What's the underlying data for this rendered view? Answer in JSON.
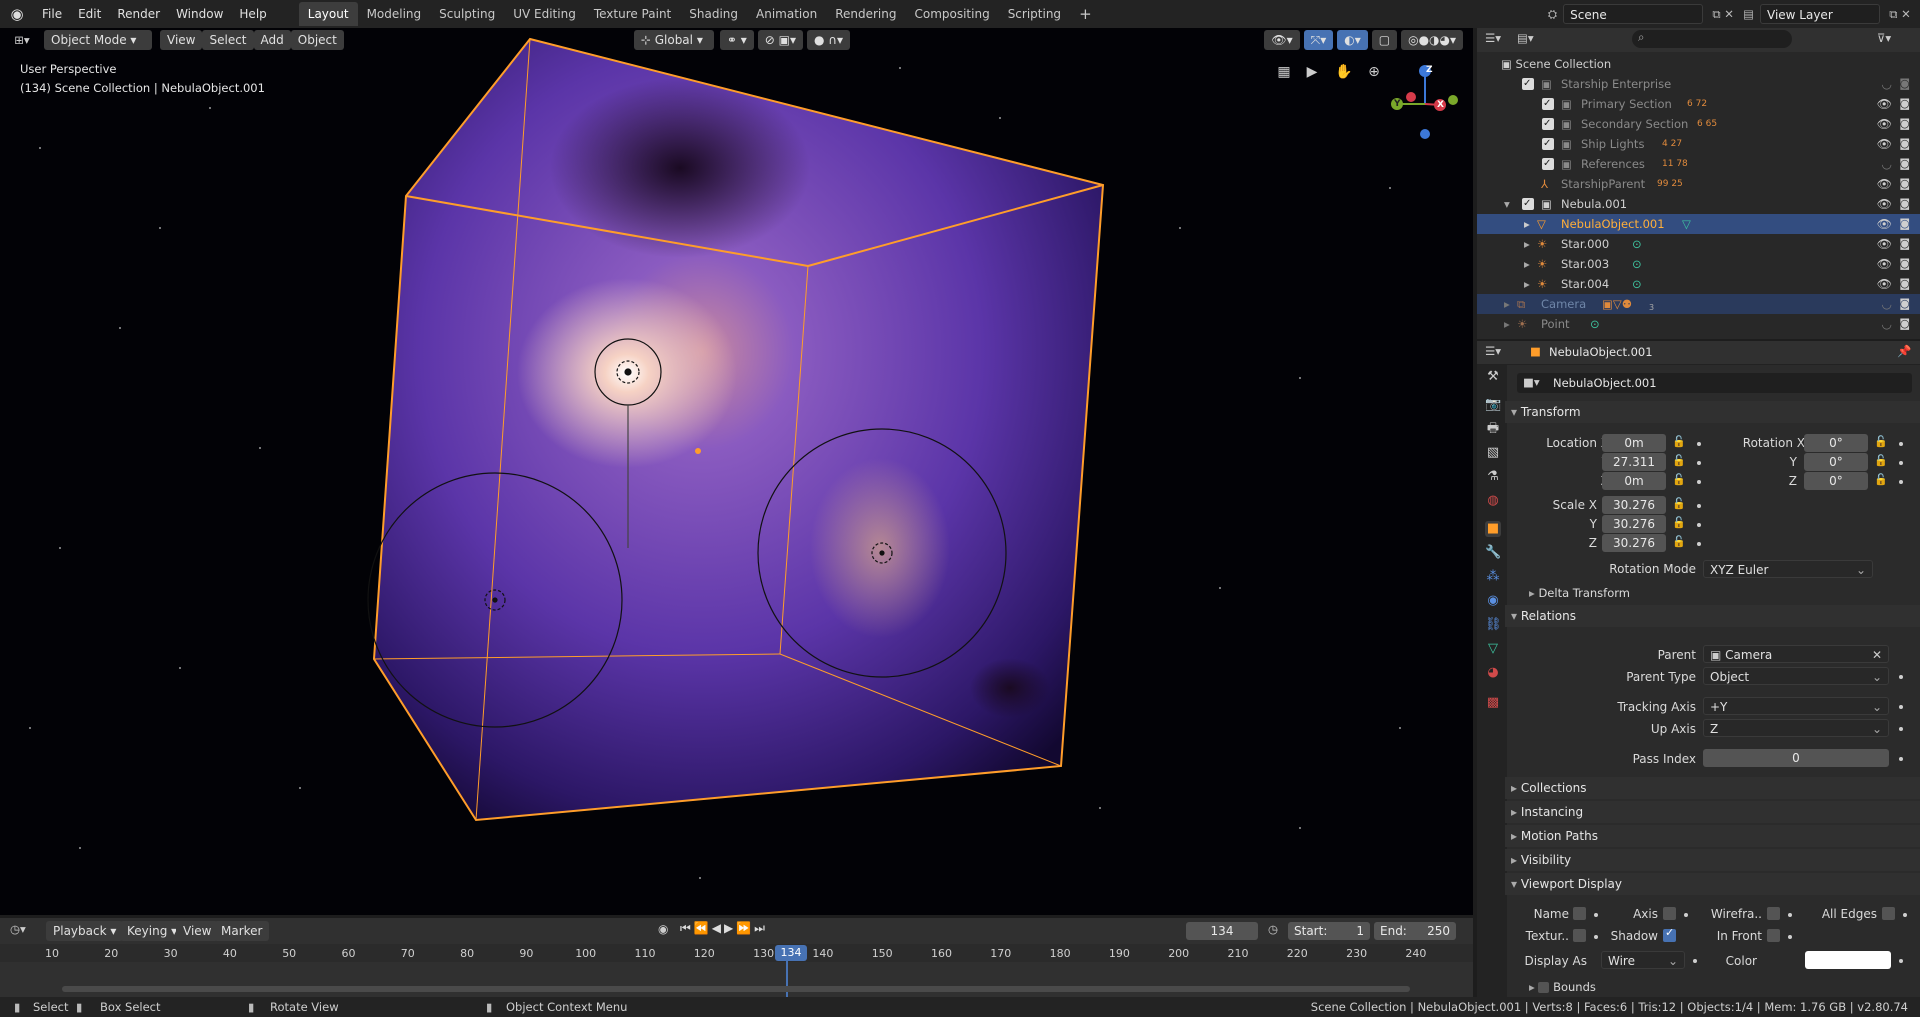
{
  "app": {
    "menus": [
      "File",
      "Edit",
      "Render",
      "Window",
      "Help"
    ],
    "workspaces": [
      "Layout",
      "Modeling",
      "Sculpting",
      "UV Editing",
      "Texture Paint",
      "Shading",
      "Animation",
      "Rendering",
      "Compositing",
      "Scripting"
    ],
    "active_workspace": "Layout",
    "scene_name": "Scene",
    "view_layer": "View Layer"
  },
  "viewport": {
    "mode": "Object Mode",
    "menus": [
      "View",
      "Select",
      "Add",
      "Object"
    ],
    "transform_orientation": "Global",
    "overlay_title": "User Perspective",
    "overlay_sub": "(134) Scene Collection | NebulaObject.001",
    "gizmo": {
      "x": "X",
      "y": "Y",
      "z": "Z"
    }
  },
  "outliner": {
    "root": "Scene Collection",
    "rows": [
      {
        "label": "Starship Enterprise",
        "badge": ""
      },
      {
        "label": "Primary Section",
        "badge": "6  72"
      },
      {
        "label": "Secondary Section",
        "badge": "6  65"
      },
      {
        "label": "Ship Lights",
        "badge": "4  27"
      },
      {
        "label": "References",
        "badge": "11 78"
      },
      {
        "label": "StarshipParent",
        "badge": "99 25"
      },
      {
        "label": "Nebula.001",
        "badge": ""
      },
      {
        "label": "NebulaObject.001",
        "badge": ""
      },
      {
        "label": "Star.000",
        "badge": ""
      },
      {
        "label": "Star.003",
        "badge": ""
      },
      {
        "label": "Star.004",
        "badge": ""
      },
      {
        "label": "Camera",
        "badge": "3"
      },
      {
        "label": "Point",
        "badge": ""
      }
    ]
  },
  "properties": {
    "object_name": "NebulaObject.001",
    "object_field": "NebulaObject.001",
    "transform_title": "Transform",
    "location_x_label": "Location X",
    "location": {
      "x": "0m",
      "y": "27.311",
      "z": "0m"
    },
    "rotation_x_label": "Rotation X",
    "rotation": {
      "x": "0°",
      "y": "0°",
      "z": "0°"
    },
    "scale_x_label": "Scale X",
    "scale": {
      "x": "30.276",
      "y": "30.276",
      "z": "30.276"
    },
    "y_label": "Y",
    "z_label": "Z",
    "rotation_mode_label": "Rotation Mode",
    "rotation_mode": "XYZ Euler",
    "delta_transform": "Delta Transform",
    "relations_title": "Relations",
    "parent_label": "Parent",
    "parent": "Camera",
    "parent_type_label": "Parent Type",
    "parent_type": "Object",
    "tracking_axis_label": "Tracking Axis",
    "tracking_axis": "+Y",
    "up_axis_label": "Up Axis",
    "up_axis": "Z",
    "pass_index_label": "Pass Index",
    "pass_index": "0",
    "collections": "Collections",
    "instancing": "Instancing",
    "motion_paths": "Motion Paths",
    "visibility": "Visibility",
    "viewport_display": "Viewport Display",
    "vd_name": "Name",
    "vd_axis": "Axis",
    "vd_wireframe": "Wirefra..",
    "vd_alledges": "All Edges",
    "vd_texture": "Textur..",
    "vd_shadow": "Shadow",
    "vd_infront": "In Front",
    "display_as_label": "Display As",
    "display_as": "Wire",
    "color_label": "Color",
    "bounds": "Bounds"
  },
  "timeline": {
    "menus": [
      "Playback",
      "Keying",
      "View",
      "Marker"
    ],
    "current_frame": "134",
    "start_label": "Start:",
    "start": "1",
    "end_label": "End:",
    "end": "250",
    "ticks": [
      "10",
      "20",
      "30",
      "40",
      "50",
      "60",
      "70",
      "80",
      "90",
      "100",
      "110",
      "120",
      "130",
      "140",
      "150",
      "160",
      "170",
      "180",
      "190",
      "200",
      "210",
      "220",
      "230",
      "240"
    ]
  },
  "status": {
    "select": "Select",
    "box_select": "Box Select",
    "rotate_view": "Rotate View",
    "context_menu": "Object Context Menu",
    "info": "Scene Collection | NebulaObject.001 | Verts:8 | Faces:6 | Tris:12 | Objects:1/4 | Mem: 1.76 GB | v2.80.74"
  },
  "colors": {
    "accent": "#4772b3",
    "selected_orange": "#ff9d2a",
    "nebula": "#6a3fb0"
  }
}
